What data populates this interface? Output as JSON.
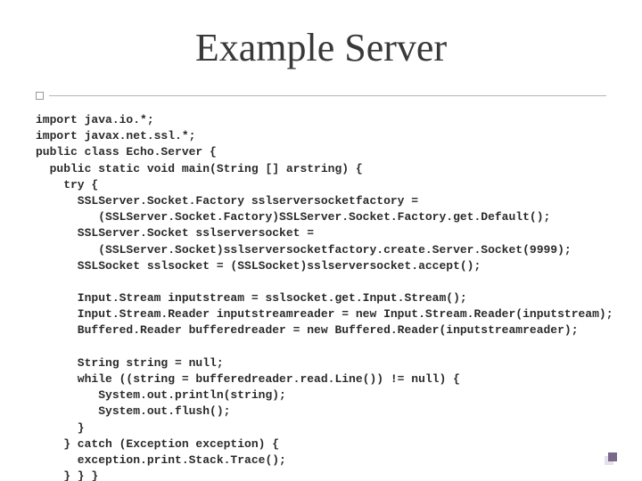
{
  "title": "Example Server",
  "code_lines": [
    "import java.io.*;",
    "import javax.net.ssl.*;",
    "public class Echo.Server {",
    "  public static void main(String [] arstring) {",
    "    try {",
    "      SSLServer.Socket.Factory sslserversocketfactory =",
    "         (SSLServer.Socket.Factory)SSLServer.Socket.Factory.get.Default();",
    "      SSLServer.Socket sslserversocket =",
    "         (SSLServer.Socket)sslserversocketfactory.create.Server.Socket(9999);",
    "      SSLSocket sslsocket = (SSLSocket)sslserversocket.accept();",
    "",
    "      Input.Stream inputstream = sslsocket.get.Input.Stream();",
    "      Input.Stream.Reader inputstreamreader = new Input.Stream.Reader(inputstream);",
    "      Buffered.Reader bufferedreader = new Buffered.Reader(inputstreamreader);",
    "",
    "      String string = null;",
    "      while ((string = bufferedreader.read.Line()) != null) {",
    "         System.out.println(string);",
    "         System.out.flush();",
    "      }",
    "    } catch (Exception exception) {",
    "      exception.print.Stack.Trace();",
    "    } } }"
  ]
}
